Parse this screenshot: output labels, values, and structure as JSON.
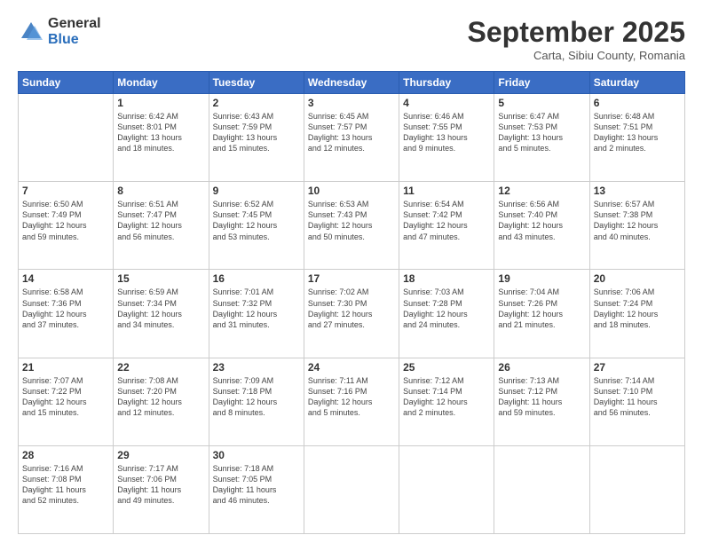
{
  "logo": {
    "general": "General",
    "blue": "Blue"
  },
  "header": {
    "month": "September 2025",
    "location": "Carta, Sibiu County, Romania"
  },
  "days_of_week": [
    "Sunday",
    "Monday",
    "Tuesday",
    "Wednesday",
    "Thursday",
    "Friday",
    "Saturday"
  ],
  "weeks": [
    [
      {
        "day": "",
        "info": ""
      },
      {
        "day": "1",
        "info": "Sunrise: 6:42 AM\nSunset: 8:01 PM\nDaylight: 13 hours\nand 18 minutes."
      },
      {
        "day": "2",
        "info": "Sunrise: 6:43 AM\nSunset: 7:59 PM\nDaylight: 13 hours\nand 15 minutes."
      },
      {
        "day": "3",
        "info": "Sunrise: 6:45 AM\nSunset: 7:57 PM\nDaylight: 13 hours\nand 12 minutes."
      },
      {
        "day": "4",
        "info": "Sunrise: 6:46 AM\nSunset: 7:55 PM\nDaylight: 13 hours\nand 9 minutes."
      },
      {
        "day": "5",
        "info": "Sunrise: 6:47 AM\nSunset: 7:53 PM\nDaylight: 13 hours\nand 5 minutes."
      },
      {
        "day": "6",
        "info": "Sunrise: 6:48 AM\nSunset: 7:51 PM\nDaylight: 13 hours\nand 2 minutes."
      }
    ],
    [
      {
        "day": "7",
        "info": "Sunrise: 6:50 AM\nSunset: 7:49 PM\nDaylight: 12 hours\nand 59 minutes."
      },
      {
        "day": "8",
        "info": "Sunrise: 6:51 AM\nSunset: 7:47 PM\nDaylight: 12 hours\nand 56 minutes."
      },
      {
        "day": "9",
        "info": "Sunrise: 6:52 AM\nSunset: 7:45 PM\nDaylight: 12 hours\nand 53 minutes."
      },
      {
        "day": "10",
        "info": "Sunrise: 6:53 AM\nSunset: 7:43 PM\nDaylight: 12 hours\nand 50 minutes."
      },
      {
        "day": "11",
        "info": "Sunrise: 6:54 AM\nSunset: 7:42 PM\nDaylight: 12 hours\nand 47 minutes."
      },
      {
        "day": "12",
        "info": "Sunrise: 6:56 AM\nSunset: 7:40 PM\nDaylight: 12 hours\nand 43 minutes."
      },
      {
        "day": "13",
        "info": "Sunrise: 6:57 AM\nSunset: 7:38 PM\nDaylight: 12 hours\nand 40 minutes."
      }
    ],
    [
      {
        "day": "14",
        "info": "Sunrise: 6:58 AM\nSunset: 7:36 PM\nDaylight: 12 hours\nand 37 minutes."
      },
      {
        "day": "15",
        "info": "Sunrise: 6:59 AM\nSunset: 7:34 PM\nDaylight: 12 hours\nand 34 minutes."
      },
      {
        "day": "16",
        "info": "Sunrise: 7:01 AM\nSunset: 7:32 PM\nDaylight: 12 hours\nand 31 minutes."
      },
      {
        "day": "17",
        "info": "Sunrise: 7:02 AM\nSunset: 7:30 PM\nDaylight: 12 hours\nand 27 minutes."
      },
      {
        "day": "18",
        "info": "Sunrise: 7:03 AM\nSunset: 7:28 PM\nDaylight: 12 hours\nand 24 minutes."
      },
      {
        "day": "19",
        "info": "Sunrise: 7:04 AM\nSunset: 7:26 PM\nDaylight: 12 hours\nand 21 minutes."
      },
      {
        "day": "20",
        "info": "Sunrise: 7:06 AM\nSunset: 7:24 PM\nDaylight: 12 hours\nand 18 minutes."
      }
    ],
    [
      {
        "day": "21",
        "info": "Sunrise: 7:07 AM\nSunset: 7:22 PM\nDaylight: 12 hours\nand 15 minutes."
      },
      {
        "day": "22",
        "info": "Sunrise: 7:08 AM\nSunset: 7:20 PM\nDaylight: 12 hours\nand 12 minutes."
      },
      {
        "day": "23",
        "info": "Sunrise: 7:09 AM\nSunset: 7:18 PM\nDaylight: 12 hours\nand 8 minutes."
      },
      {
        "day": "24",
        "info": "Sunrise: 7:11 AM\nSunset: 7:16 PM\nDaylight: 12 hours\nand 5 minutes."
      },
      {
        "day": "25",
        "info": "Sunrise: 7:12 AM\nSunset: 7:14 PM\nDaylight: 12 hours\nand 2 minutes."
      },
      {
        "day": "26",
        "info": "Sunrise: 7:13 AM\nSunset: 7:12 PM\nDaylight: 11 hours\nand 59 minutes."
      },
      {
        "day": "27",
        "info": "Sunrise: 7:14 AM\nSunset: 7:10 PM\nDaylight: 11 hours\nand 56 minutes."
      }
    ],
    [
      {
        "day": "28",
        "info": "Sunrise: 7:16 AM\nSunset: 7:08 PM\nDaylight: 11 hours\nand 52 minutes."
      },
      {
        "day": "29",
        "info": "Sunrise: 7:17 AM\nSunset: 7:06 PM\nDaylight: 11 hours\nand 49 minutes."
      },
      {
        "day": "30",
        "info": "Sunrise: 7:18 AM\nSunset: 7:05 PM\nDaylight: 11 hours\nand 46 minutes."
      },
      {
        "day": "",
        "info": ""
      },
      {
        "day": "",
        "info": ""
      },
      {
        "day": "",
        "info": ""
      },
      {
        "day": "",
        "info": ""
      }
    ]
  ]
}
